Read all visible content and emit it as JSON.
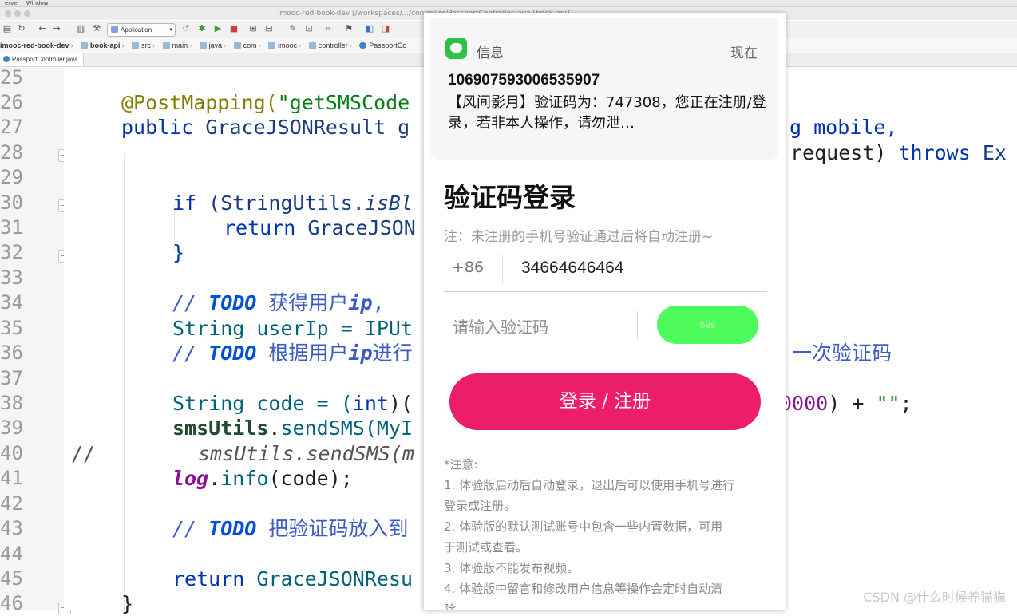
{
  "menubar": {
    "items": [
      "erver",
      "Window"
    ]
  },
  "window": {
    "title": "imooc-red-book-dev [/workspaces/.../controller/PassportController.java [book-api]"
  },
  "toolbar": {
    "run_config": "Application"
  },
  "navbar": {
    "crumbs": [
      "imooc-red-book-dev",
      "book-api",
      "src",
      "main",
      "java",
      "com",
      "imooc",
      "controller",
      "PassportCo"
    ]
  },
  "editor_tab": {
    "label": "PassportController.java"
  },
  "editor": {
    "line_numbers": [
      "25",
      "26",
      "27",
      "28",
      "29",
      "30",
      "31",
      "32",
      "33",
      "34",
      "35",
      "36",
      "37",
      "38",
      "39",
      "40",
      "41",
      "42",
      "43",
      "44",
      "45",
      "46"
    ],
    "code": {
      "l26_ann": "@PostMapping(",
      "l26_str": "\"getSMSCode",
      "l27_kw": "public ",
      "l27_type": "GraceJSONResult g",
      "l27_rest": "g mobile,",
      "l28_rest": "request) ",
      "l28_throws": "throws",
      "l28_ex": " Ex",
      "l30_if": "if",
      "l30_mid": " (StringUtils.",
      "l30_it": "isBl",
      "l31_ret": "return",
      "l31_rest": " GraceJSON",
      "l32": "}",
      "l34_c": "// ",
      "l34_todo": "TODO",
      "l34_txt": " 获得用户",
      "l34_ip": "ip",
      "l34_end": ",",
      "l35": "String userIp = IPUt",
      "l36_c": "// ",
      "l36_todo": "TODO",
      "l36_txt": " 根据用户",
      "l36_ip": "ip",
      "l36_end": "进行",
      "l36_tail": "一次验证码",
      "l38_a": "String code = (",
      "l38_int": "int",
      "l38_b": ")(",
      "l38_num": "0000",
      "l38_c": ") + ",
      "l38_str": "\"\"",
      "l38_d": ";",
      "l39_field": "smsUtils",
      "l39_dot": ".",
      "l39_meth": "sendSMS",
      "l39_rest": "(MyI",
      "l40_slash": "//",
      "l40_txt": "smsUtils.sendSMS(m",
      "l41_log": "log",
      "l41_dot": ".",
      "l41_meth": "info",
      "l41_rest": "(code);",
      "l43_c": "// ",
      "l43_todo": "TODO",
      "l43_txt": " 把验证码放入到",
      "l45_ret": "return",
      "l45_rest": " GraceJSONResu",
      "l46": "}"
    }
  },
  "phone": {
    "notification": {
      "app": "信息",
      "time": "现在",
      "sender": "106907593006535907",
      "body": "【风间影月】验证码为：747308，您正在注册/登录，若非本人操作，请勿泄…"
    },
    "login": {
      "title": "验证码登录",
      "note": "注：未注册的手机号验证通过后将自动注册~",
      "country_code": "+86",
      "phone_value": "34664646464",
      "code_placeholder": "请输入验证码",
      "countdown": "59s",
      "submit": "登录 / 注册",
      "tips_title": "*注意:",
      "tips": [
        "1. 体验版启动后自动登录，退出后可以使用手机号进行",
        "登录或注册。",
        "2. 体验版的默认测试账号中包含一些内置数据，可用",
        "于测试或查看。",
        "3. 体验版不能发布视频。",
        "4. 体验版中留言和修改用户信息等操作会定时自动清",
        "除。"
      ]
    }
  },
  "watermark": "CSDN @什么时候养猫猫",
  "colors": {
    "accent_pink": "#ec1e69",
    "sms_green": "#4dfc5c",
    "notif_green": "#2ec24b"
  }
}
